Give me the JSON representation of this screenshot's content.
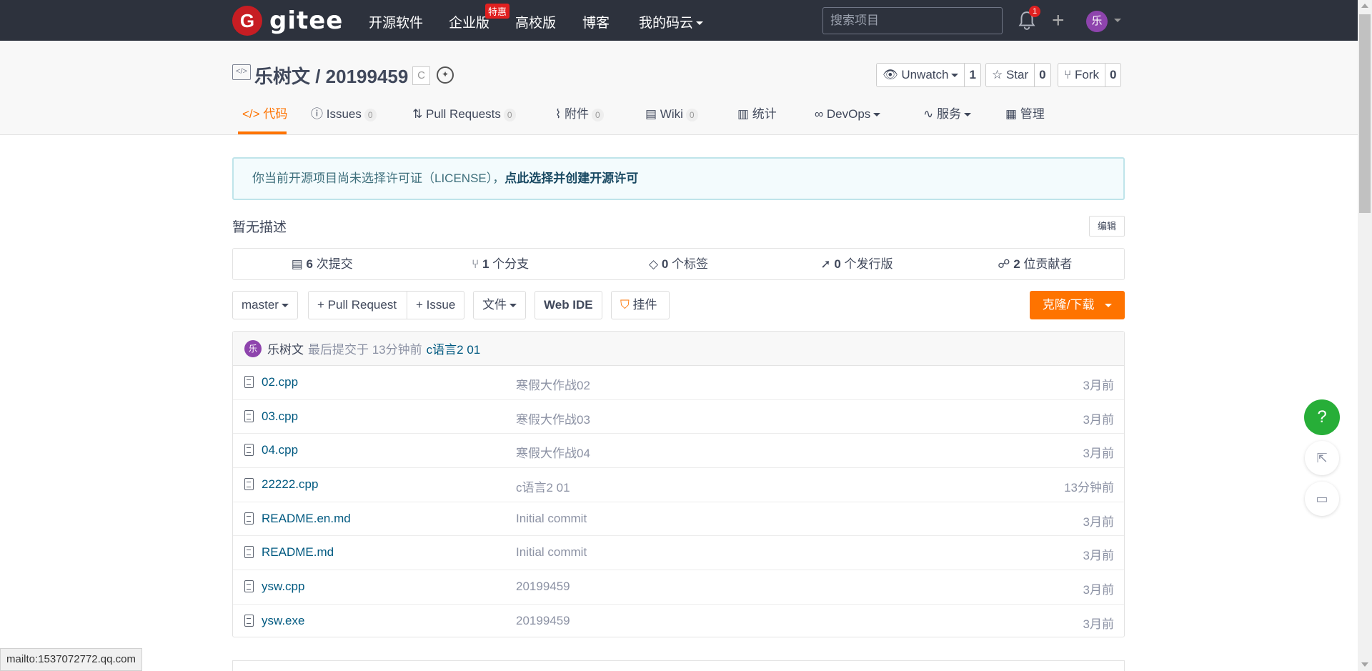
{
  "nav": {
    "logo_mark": "G",
    "logo_text": "gitee",
    "items": [
      "开源软件",
      "企业版",
      "高校版",
      "博客",
      "我的码云"
    ],
    "enterprise_badge": "特惠",
    "search_placeholder": "搜索项目",
    "notification_count": "1",
    "user_initial": "乐"
  },
  "repo": {
    "title": "乐树文 / 20199459",
    "language": "C",
    "watch": {
      "label": "Unwatch",
      "count": "1"
    },
    "star": {
      "label": "Star",
      "count": "0"
    },
    "fork": {
      "label": "Fork",
      "count": "0"
    }
  },
  "tabs": [
    {
      "label": "代码",
      "count": null
    },
    {
      "label": "Issues",
      "count": "0"
    },
    {
      "label": "Pull Requests",
      "count": "0"
    },
    {
      "label": "附件",
      "count": "0"
    },
    {
      "label": "Wiki",
      "count": "0"
    },
    {
      "label": "统计",
      "count": null
    },
    {
      "label": "DevOps",
      "count": null
    },
    {
      "label": "服务",
      "count": null
    },
    {
      "label": "管理",
      "count": null
    }
  ],
  "notice": {
    "text": "你当前开源项目尚未选择许可证（LICENSE），",
    "link": "点此选择并创建开源许可"
  },
  "description": "暂无描述",
  "edit_label": "编辑",
  "stats": [
    {
      "num": "6",
      "label": "次提交"
    },
    {
      "num": "1",
      "label": "个分支"
    },
    {
      "num": "0",
      "label": "个标签"
    },
    {
      "num": "0",
      "label": "个发行版"
    },
    {
      "num": "2",
      "label": "位贡献者"
    }
  ],
  "toolbar": {
    "branch": "master",
    "pull_request": "+ Pull Request",
    "issue": "+ Issue",
    "file": "文件",
    "web_ide": "Web IDE",
    "widget": "挂件",
    "clone": "克隆/下载"
  },
  "last_commit": {
    "avatar": "乐",
    "author": "乐树文",
    "meta": "最后提交于 13分钟前",
    "message": "c语言2 01"
  },
  "files": [
    {
      "name": "02.cpp",
      "message": "寒假大作战02",
      "time": "3月前"
    },
    {
      "name": "03.cpp",
      "message": "寒假大作战03",
      "time": "3月前"
    },
    {
      "name": "04.cpp",
      "message": "寒假大作战04",
      "time": "3月前"
    },
    {
      "name": "22222.cpp",
      "message": "c语言2 01",
      "time": "13分钟前"
    },
    {
      "name": "README.en.md",
      "message": "Initial commit",
      "time": "3月前"
    },
    {
      "name": "README.md",
      "message": "Initial commit",
      "time": "3月前"
    },
    {
      "name": "ysw.cpp",
      "message": "20199459",
      "time": "3月前"
    },
    {
      "name": "ysw.exe",
      "message": "20199459",
      "time": "3月前"
    }
  ],
  "float": {
    "help": "?"
  },
  "status_url": "mailto:1537072772.qq.com"
}
